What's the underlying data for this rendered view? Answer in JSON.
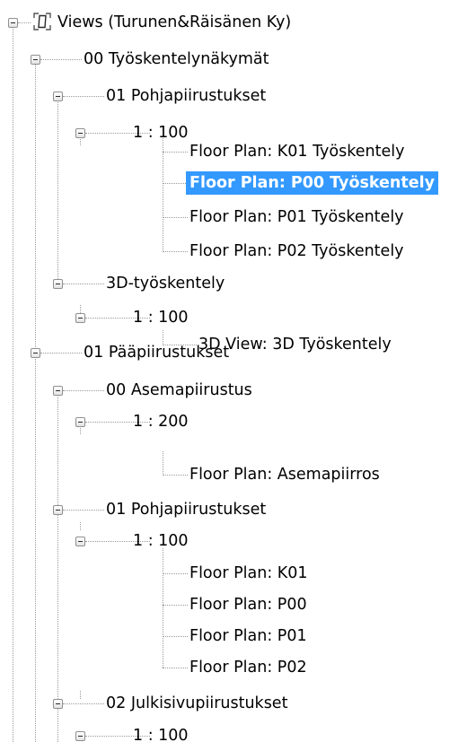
{
  "tree": {
    "root_label": "Views (Turunen&Räisänen Ky)",
    "root_icon": "views-icon",
    "selected_item": "Floor Plan: P00 Työskentely",
    "nodes": [
      {
        "label": "Views (Turunen&Räisänen Ky)",
        "depth": 0,
        "expanded": true
      },
      {
        "label": "00 Työskentelynäkymät",
        "depth": 1,
        "expanded": true
      },
      {
        "label": "01 Pohjapiirustukset",
        "depth": 2,
        "expanded": true
      },
      {
        "label": "1 : 100",
        "depth": 3,
        "expanded": true
      },
      {
        "label": "Floor Plan: K01 Työskentely",
        "depth": 4
      },
      {
        "label": "Floor Plan: P00 Työskentely",
        "depth": 4,
        "selected": true
      },
      {
        "label": "Floor Plan: P01 Työskentely",
        "depth": 4
      },
      {
        "label": "Floor Plan: P02 Työskentely",
        "depth": 4
      },
      {
        "label": "3D-työskentely",
        "depth": 2,
        "expanded": true
      },
      {
        "label": "1 : 100",
        "depth": 3,
        "expanded": true
      },
      {
        "label": "3D View: 3D Työskentely",
        "depth": 4
      },
      {
        "label": "01 Pääpiirustukset",
        "depth": 1,
        "expanded": true
      },
      {
        "label": "00 Asemapiirustus",
        "depth": 2,
        "expanded": true
      },
      {
        "label": "1 : 200",
        "depth": 3,
        "expanded": true
      },
      {
        "label": "Floor Plan: Asemapiirros",
        "depth": 4
      },
      {
        "label": "01 Pohjapiirustukset",
        "depth": 2,
        "expanded": true
      },
      {
        "label": "1 : 100",
        "depth": 3,
        "expanded": true
      },
      {
        "label": "Floor Plan: K01",
        "depth": 4
      },
      {
        "label": "Floor Plan: P00",
        "depth": 4
      },
      {
        "label": "Floor Plan: P01",
        "depth": 4
      },
      {
        "label": "Floor Plan: P02",
        "depth": 4
      },
      {
        "label": "02 Julkisivupiirustukset",
        "depth": 2,
        "expanded": true
      },
      {
        "label": "1 : 100",
        "depth": 3,
        "expanded": true
      }
    ]
  },
  "colors": {
    "selection_background": "#3399ff",
    "selection_text": "#ffffff",
    "tree_lines": "#9a9a9a",
    "text": "#000000"
  }
}
